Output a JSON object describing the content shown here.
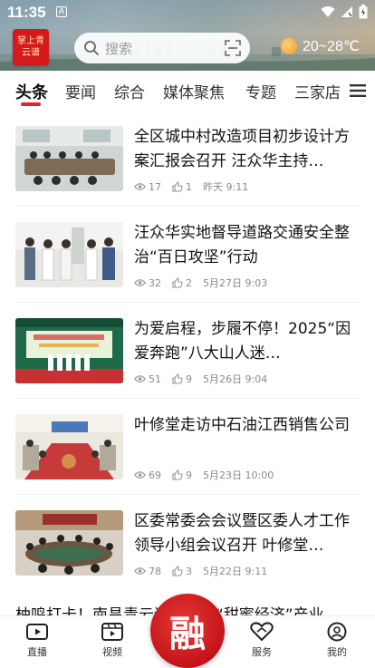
{
  "status": {
    "time": "11:35",
    "a_label": "A"
  },
  "header": {
    "logo_text": "掌上青云谱",
    "search_placeholder": "搜索",
    "weather_temp": "20~28℃"
  },
  "tabs": [
    {
      "label": "头条",
      "active": true
    },
    {
      "label": "要闻"
    },
    {
      "label": "综合"
    },
    {
      "label": "媒体聚焦"
    },
    {
      "label": "专题"
    },
    {
      "label": "三家店"
    }
  ],
  "news": [
    {
      "title": "全区城中村改造项目初步设计方案汇报会召开 汪众华主持…",
      "views": "17",
      "likes": "1",
      "time": "昨天 9:11"
    },
    {
      "title": "汪众华实地督导道路交通安全整治“百日攻坚”行动",
      "views": "32",
      "likes": "2",
      "time": "5月27日 9:03"
    },
    {
      "title": "为爱启程，步履不停！2025“因爱奔跑”八大山人迷…",
      "views": "51",
      "likes": "9",
      "time": "5月26日 9:04"
    },
    {
      "title": "叶修堂走访中石油江西销售公司",
      "views": "69",
      "likes": "9",
      "time": "5月23日 10:00"
    },
    {
      "title": "区委常委会会议暨区委人才工作领导小组会议召开 叶修堂…",
      "views": "78",
      "likes": "3",
      "time": "5月22日 9:11"
    }
  ],
  "partial_title": "柚鸣打卡！南昌青云谱区推动“甜蜜经济”产业",
  "bottom_nav": {
    "live": "直播",
    "video": "视频",
    "center": "融",
    "service": "服务",
    "mine": "我的"
  },
  "colors": {
    "accent": "#e02525",
    "brand_red": "#c4131a"
  }
}
